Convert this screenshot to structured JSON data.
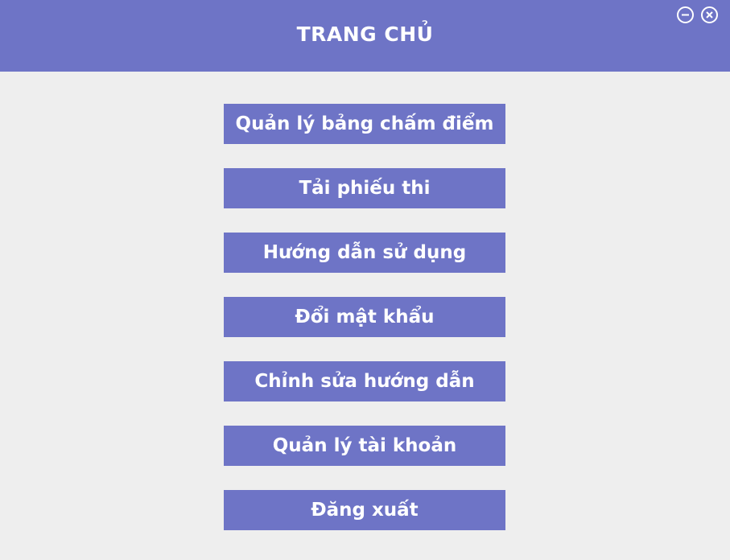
{
  "header": {
    "title": "TRANG CHỦ"
  },
  "window_controls": {
    "minimize_icon": "minimize-circle-icon",
    "close_icon": "close-circle-icon"
  },
  "menu": {
    "items": [
      {
        "label": "Quản lý bảng chấm điểm"
      },
      {
        "label": "Tải phiếu thi"
      },
      {
        "label": "Hướng dẫn sử dụng"
      },
      {
        "label": "Đổi mật khẩu"
      },
      {
        "label": "Chỉnh sửa hướng dẫn"
      },
      {
        "label": "Quản lý tài khoản"
      },
      {
        "label": "Đăng xuất"
      }
    ]
  },
  "colors": {
    "accent": "#6e74c6",
    "background": "#eeeeee",
    "text_on_accent": "#ffffff"
  }
}
